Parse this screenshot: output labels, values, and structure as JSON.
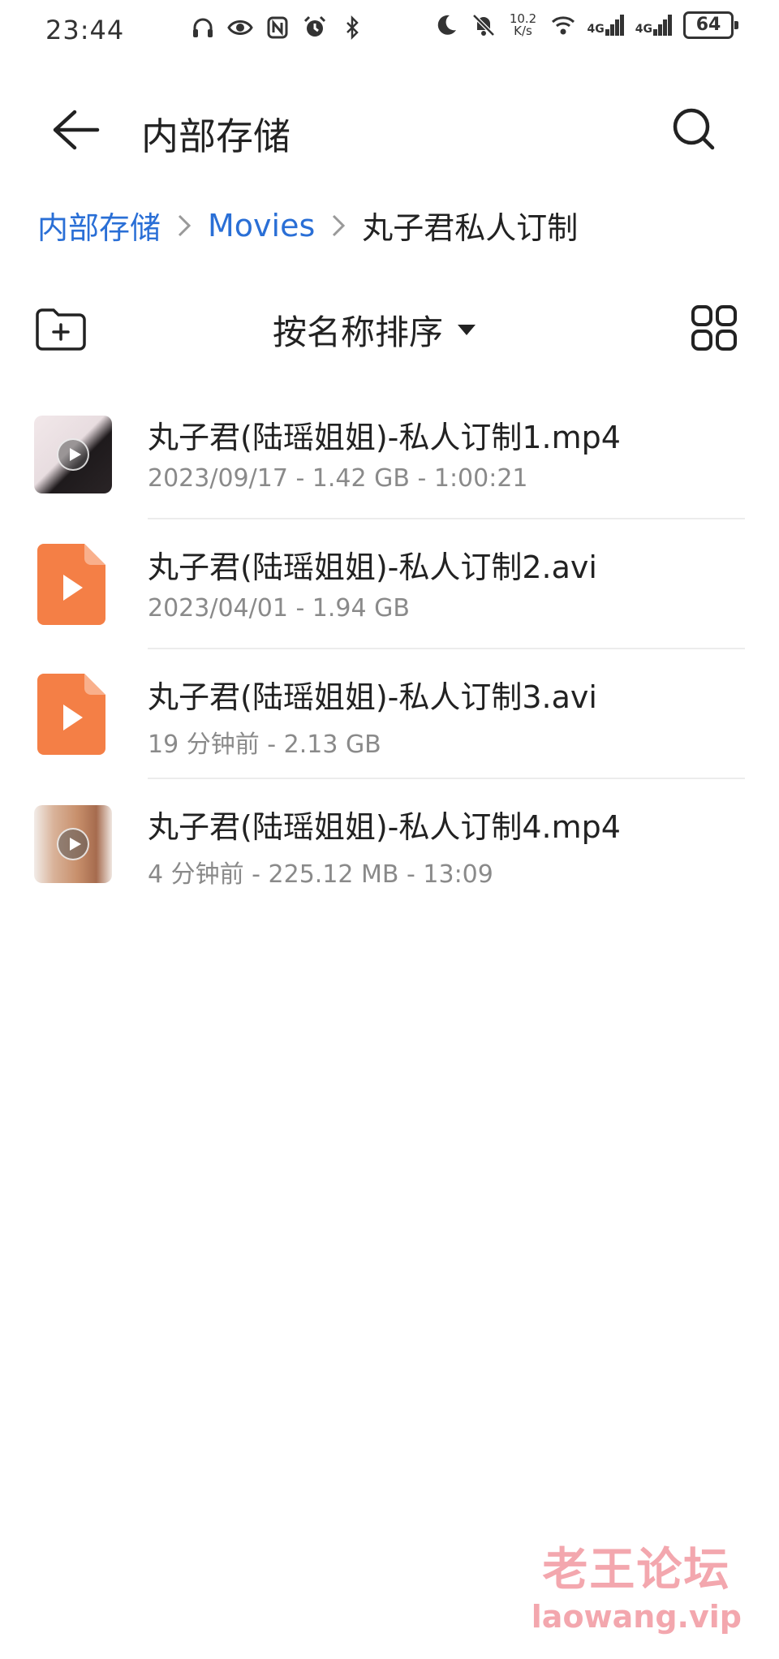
{
  "status_bar": {
    "time": "23:44",
    "left_icons": [
      "headphones-icon",
      "eye-icon",
      "nfc-icon",
      "alarm-icon",
      "bluetooth-icon"
    ],
    "net_speed_value": "10.2",
    "net_speed_unit": "K/s",
    "signal1_label": "4G",
    "signal2_label": "4G",
    "battery": "64"
  },
  "appbar": {
    "title": "内部存储"
  },
  "breadcrumb": {
    "items": [
      "内部存储",
      "Movies"
    ],
    "current": "丸子君私人订制"
  },
  "toolbar": {
    "sort_label": "按名称排序"
  },
  "files": [
    {
      "name": "丸子君(陆瑶姐姐)-私人订制1.mp4",
      "meta": "2023/09/17 - 1.42 GB - 1:00:21",
      "thumb": "video-thumbnail"
    },
    {
      "name": "丸子君(陆瑶姐姐)-私人订制2.avi",
      "meta": "2023/04/01 - 1.94 GB",
      "thumb": "video-file-icon"
    },
    {
      "name": "丸子君(陆瑶姐姐)-私人订制3.avi",
      "meta": "19 分钟前 - 2.13 GB",
      "thumb": "video-file-icon"
    },
    {
      "name": "丸子君(陆瑶姐姐)-私人订制4.mp4",
      "meta": "4 分钟前 - 225.12 MB - 13:09",
      "thumb": "video-thumbnail"
    }
  ],
  "colors": {
    "link": "#2a6fd6",
    "file_icon": "#f47f46",
    "watermark": "#f3a7ae"
  },
  "watermark": {
    "text_cn": "老王论坛",
    "text_en": "laowang.vip"
  }
}
